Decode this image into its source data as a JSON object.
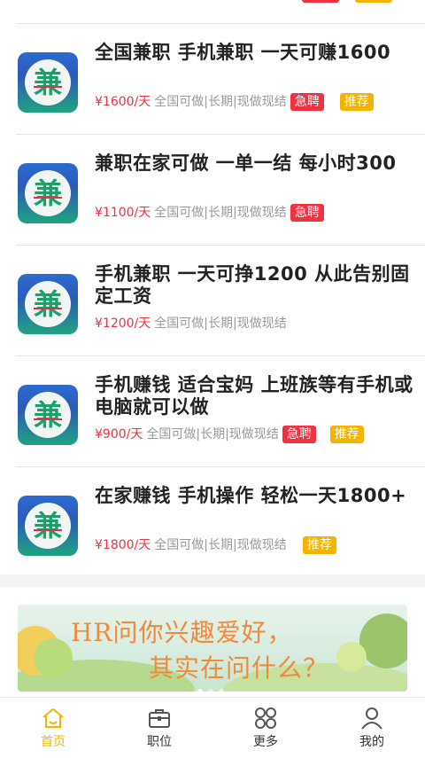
{
  "jobs": [
    {
      "title": "全国兼职 手机兼职 一天可赚1600",
      "price": "¥1600/天",
      "desc": "全国可做|长期|现做现结",
      "urgent": "急聘",
      "recommended": "推荐"
    },
    {
      "title": "兼职在家可做 一单一结 每小时300",
      "price": "¥1100/天",
      "desc": "全国可做|长期|现做现结",
      "urgent": "急聘",
      "recommended": ""
    },
    {
      "title": "手机兼职 一天可挣1200 从此告别固定工资",
      "price": "¥1200/天",
      "desc": "全国可做|长期|现做现结",
      "urgent": "",
      "recommended": ""
    },
    {
      "title": "手机赚钱 适合宝妈 上班族等有手机或电脑就可以做",
      "price": "¥900/天",
      "desc": "全国可做|长期|现做现结",
      "urgent": "急聘",
      "recommended": "推荐"
    },
    {
      "title": "在家赚钱 手机操作 轻松一天1800+",
      "price": "¥1800/天",
      "desc": "全国可做|长期|现做现结",
      "urgent": "",
      "recommended": "推荐"
    }
  ],
  "logo_glyph": "兼",
  "banner": {
    "line1": "HR问你兴趣爱好，",
    "line2": "其实在问什么？"
  },
  "tabbar": [
    {
      "label": "首页",
      "icon": "home-icon",
      "active": true
    },
    {
      "label": "职位",
      "icon": "briefcase-icon",
      "active": false
    },
    {
      "label": "更多",
      "icon": "grid-icon",
      "active": false
    },
    {
      "label": "我的",
      "icon": "user-icon",
      "active": false
    }
  ],
  "colors": {
    "accent": "#f3b400",
    "urgent": "#f0313f",
    "price": "#f0313f"
  }
}
